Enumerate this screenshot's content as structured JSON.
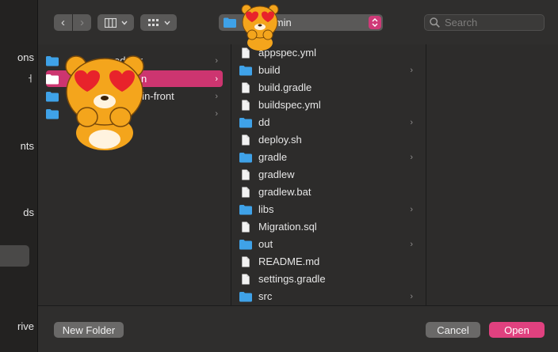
{
  "colors": {
    "accent": "#cd3570",
    "folder": "#3fa2e8"
  },
  "sidebar": {
    "items": [
      "ons",
      "ㅓ",
      "nts",
      "ds",
      "rive"
    ]
  },
  "toolbar": {
    "back_icon": "‹",
    "forward_icon": "›",
    "location": "-admin",
    "search_placeholder": "Search"
  },
  "column1": {
    "items": [
      {
        "label": "eduler",
        "selected": false
      },
      {
        "label": "n",
        "selected": true
      },
      {
        "label": "admin-front",
        "selected": false
      },
      {
        "label": "",
        "selected": false
      }
    ]
  },
  "column2": {
    "items": [
      {
        "label": "appspec.yml",
        "type": "file",
        "chevron": false
      },
      {
        "label": "build",
        "type": "folder",
        "chevron": true
      },
      {
        "label": "build.gradle",
        "type": "file",
        "chevron": false
      },
      {
        "label": "buildspec.yml",
        "type": "file",
        "chevron": false
      },
      {
        "label": "dd",
        "type": "folder",
        "chevron": true
      },
      {
        "label": "deploy.sh",
        "type": "file",
        "chevron": false
      },
      {
        "label": "gradle",
        "type": "folder",
        "chevron": true
      },
      {
        "label": "gradlew",
        "type": "file",
        "chevron": false
      },
      {
        "label": "gradlew.bat",
        "type": "file",
        "chevron": false
      },
      {
        "label": "libs",
        "type": "folder",
        "chevron": true
      },
      {
        "label": "Migration.sql",
        "type": "file",
        "chevron": false
      },
      {
        "label": "out",
        "type": "folder",
        "chevron": true
      },
      {
        "label": "README.md",
        "type": "file",
        "chevron": false
      },
      {
        "label": "settings.gradle",
        "type": "file",
        "chevron": false
      },
      {
        "label": "src",
        "type": "folder",
        "chevron": true
      }
    ]
  },
  "footer": {
    "new_folder": "New Folder",
    "cancel": "Cancel",
    "open": "Open"
  }
}
